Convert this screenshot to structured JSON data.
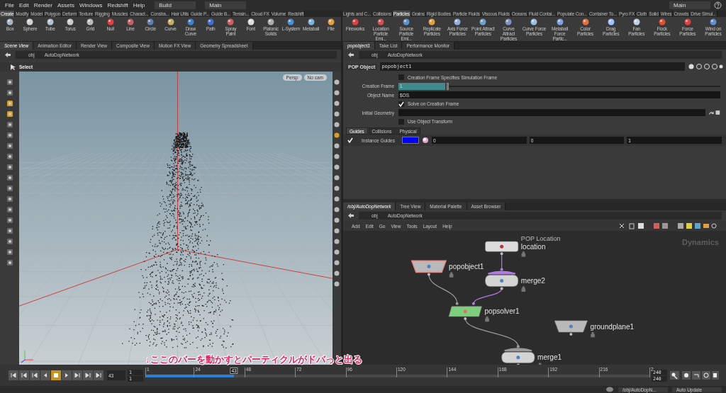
{
  "menu": [
    "File",
    "Edit",
    "Render",
    "Assets",
    "Windows",
    "Redshift",
    "Help"
  ],
  "desktop": "Build",
  "workspace": "Main",
  "right_workspace": "Main",
  "left_shelf": {
    "tabs": [
      {
        "label": "Create",
        "selected": true
      },
      {
        "label": "Modify",
        "selected": false
      },
      {
        "label": "Model",
        "selected": false
      },
      {
        "label": "Polygon",
        "selected": false
      },
      {
        "label": "Deform",
        "selected": false
      },
      {
        "label": "Texture",
        "selected": false
      },
      {
        "label": "Rigging",
        "selected": false
      },
      {
        "label": "Muscles",
        "selected": false
      },
      {
        "label": "Charact...",
        "selected": false
      },
      {
        "label": "Constra...",
        "selected": false
      },
      {
        "label": "Hair Utils",
        "selected": false
      },
      {
        "label": "Guide P...",
        "selected": false
      },
      {
        "label": "Guide B...",
        "selected": false
      },
      {
        "label": "Terrain...",
        "selected": false
      },
      {
        "label": "Cloud FX",
        "selected": false
      },
      {
        "label": "Volume",
        "selected": false
      },
      {
        "label": "Redshift",
        "selected": false
      }
    ],
    "tools": [
      "Box",
      "Sphere",
      "Tube",
      "Torus",
      "Grid",
      "Null",
      "Line",
      "Circle",
      "Curve",
      "Draw Curve",
      "Path",
      "Spray Paint",
      "Font",
      "Platonic Solids",
      "L-System",
      "Metaball",
      "File"
    ]
  },
  "right_shelf": {
    "tabs": [
      {
        "label": "Lights and C...",
        "selected": false
      },
      {
        "label": "Collisions",
        "selected": false
      },
      {
        "label": "Particles",
        "selected": true
      },
      {
        "label": "Grains",
        "selected": false
      },
      {
        "label": "Rigid Bodies",
        "selected": false
      },
      {
        "label": "Particle Fluids",
        "selected": false
      },
      {
        "label": "Viscous Fluids",
        "selected": false
      },
      {
        "label": "Oceans",
        "selected": false
      },
      {
        "label": "Fluid Contai...",
        "selected": false
      },
      {
        "label": "Populate Con...",
        "selected": false
      },
      {
        "label": "Container To...",
        "selected": false
      },
      {
        "label": "Pyro FX",
        "selected": false
      },
      {
        "label": "Cloth",
        "selected": false
      },
      {
        "label": "Solid",
        "selected": false
      },
      {
        "label": "Wires",
        "selected": false
      },
      {
        "label": "Crowds",
        "selected": false
      },
      {
        "label": "Drive Simul...",
        "selected": false
      }
    ],
    "tools": [
      "Fireworks",
      "Location Particle Emi...",
      "Source Particle Emi...",
      "Replicate Particles",
      "Axis Force Particles",
      "Point Attract Particles",
      "Curve Attract Particles",
      "Curve Force Particles",
      "Metaball Force Partic...",
      "Color Particles",
      "Drag Particles",
      "Fan Particles",
      "Flock Particles",
      "Force Particles",
      "Wind on Particles"
    ]
  },
  "scene_view": {
    "tabs": [
      {
        "label": "Scene View",
        "selected": true
      },
      {
        "label": "Animation Editor",
        "selected": false
      },
      {
        "label": "Render View",
        "selected": false
      },
      {
        "label": "Composite View",
        "selected": false
      },
      {
        "label": "Motion FX View",
        "selected": false
      },
      {
        "label": "Geometry Spreadsheet",
        "selected": false
      }
    ],
    "path": [
      "obj",
      "AutoDopNetwork"
    ],
    "tool": "Select",
    "camera_buttons": [
      "Persp",
      "No cam"
    ],
    "annotation": "↓ここのバーを動かすとパーティクルがドバっと出る"
  },
  "parameters": {
    "tabs": [
      {
        "label": "popobject1",
        "selected": true
      },
      {
        "label": "Take List",
        "selected": false
      },
      {
        "label": "Performance Monitor",
        "selected": false
      }
    ],
    "path": [
      "obj",
      "AutoDopNetwork"
    ],
    "node_type": "POP Object",
    "node_name": "popobject1",
    "rows": [
      {
        "kind": "checkbox",
        "label": "Creation Frame Specifies Simulation Frame",
        "checked": false
      },
      {
        "kind": "slider",
        "label": "Creation Frame",
        "value": "1",
        "level": 0
      },
      {
        "kind": "text",
        "label": "Object Name",
        "value": "$OS"
      },
      {
        "kind": "checkbox",
        "label": "Solve on Creation Frame",
        "checked": true
      },
      {
        "kind": "file",
        "label": "Initial Geometry"
      },
      {
        "kind": "checkbox",
        "label": "Use Object Transform",
        "checked": false
      }
    ],
    "sub_tabs": [
      {
        "label": "Guides",
        "selected": true
      },
      {
        "label": "Collisions",
        "selected": false
      },
      {
        "label": "Physical",
        "selected": false
      }
    ],
    "guides": {
      "checked": true,
      "label": "Instance Guides",
      "color": "#0000ff",
      "values": [
        "0",
        "0",
        "1"
      ]
    }
  },
  "network": {
    "tabs": [
      {
        "label": "/obj/AutoDopNetwork",
        "selected": true
      },
      {
        "label": "Tree View",
        "selected": false
      },
      {
        "label": "Material Palette",
        "selected": false
      },
      {
        "label": "Asset Browser",
        "selected": false
      }
    ],
    "path": [
      "obj",
      "AutoDopNetwork"
    ],
    "menu": [
      "Add",
      "Edit",
      "Go",
      "View",
      "Tools",
      "Layout",
      "Help"
    ],
    "context": "Dynamics",
    "nodes": [
      {
        "name": "location",
        "type_label": "POP Location",
        "kind": "source",
        "selected": false
      },
      {
        "name": "popobject1",
        "kind": "object",
        "selected": true
      },
      {
        "name": "merge2",
        "kind": "merge",
        "selected": false
      },
      {
        "name": "popsolver1",
        "kind": "solver",
        "selected": false
      },
      {
        "name": "groundplane1",
        "kind": "object",
        "selected": false
      },
      {
        "name": "merge1",
        "kind": "merge",
        "selected": false
      }
    ]
  },
  "playbar": {
    "frame": "43",
    "start": [
      "1",
      "1"
    ],
    "end": [
      "240",
      "240"
    ],
    "current": "43",
    "level": 0.176,
    "ticks": [
      "1",
      "24",
      "48",
      "72",
      "96",
      "120",
      "144",
      "168",
      "192",
      "216",
      "2"
    ]
  },
  "status": {
    "path": "/obj/AutoDopN...",
    "update": "Auto Update"
  }
}
